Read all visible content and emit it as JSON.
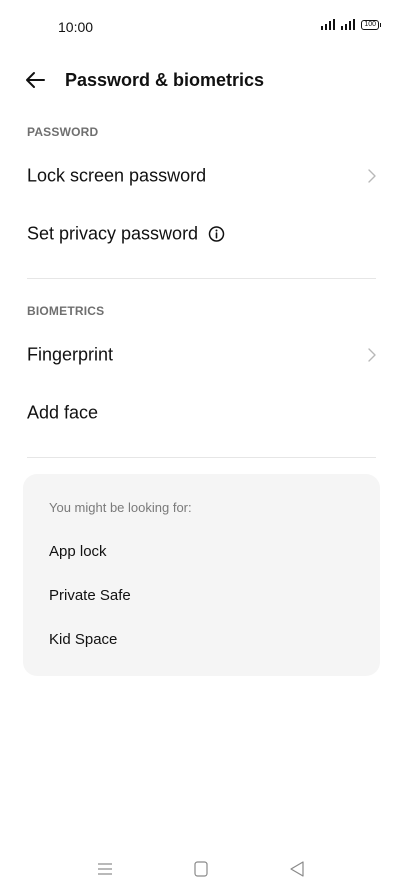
{
  "status": {
    "time": "10:00",
    "battery": "100"
  },
  "header": {
    "title": "Password & biometrics"
  },
  "sections": {
    "password": {
      "title": "PASSWORD",
      "items": [
        {
          "label": "Lock screen password"
        },
        {
          "label": "Set privacy password"
        }
      ]
    },
    "biometrics": {
      "title": "BIOMETRICS",
      "items": [
        {
          "label": "Fingerprint"
        },
        {
          "label": "Add face"
        }
      ]
    }
  },
  "suggestions": {
    "title": "You might be looking for:",
    "items": [
      {
        "label": "App lock"
      },
      {
        "label": "Private Safe"
      },
      {
        "label": "Kid Space"
      }
    ]
  },
  "icons": {
    "back": "arrow-left-icon",
    "chevron": "chevron-right-icon",
    "info": "info-icon",
    "nav": [
      "menu-icon",
      "home-square-icon",
      "back-triangle-icon"
    ]
  }
}
